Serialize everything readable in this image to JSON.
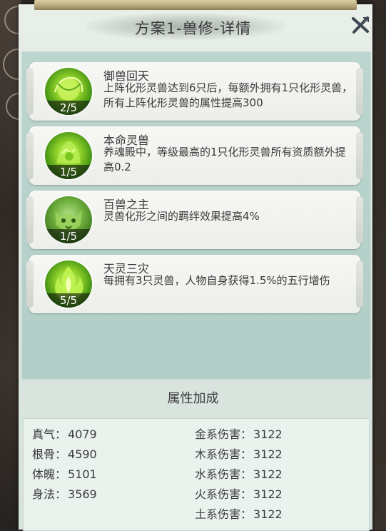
{
  "header": {
    "title": "方案1-兽修-详情"
  },
  "close_icon": "close-x-icon",
  "skills": [
    {
      "name": "御兽回天",
      "desc": "上阵化形灵兽达到6只后，每额外拥有1只化形灵兽，所有上阵化形灵兽的属性提高300",
      "level": "2/5",
      "icon": "green-beast-orb-icon"
    },
    {
      "name": "本命灵兽",
      "desc": "养魂殿中，等级最高的1只化形灵兽所有资质额外提高0.2",
      "level": "1/5",
      "icon": "green-beast-spirit-icon"
    },
    {
      "name": "百兽之主",
      "desc": "灵兽化形之间的羁绊效果提高4%",
      "level": "1/5",
      "icon": "green-tiger-head-icon"
    },
    {
      "name": "天灵三灾",
      "desc": "每拥有3只灵兽，人物自身获得1.5%的五行增伤",
      "level": "5/5",
      "icon": "green-spirit-flame-icon"
    }
  ],
  "attributes": {
    "title": "属性加成",
    "left": [
      {
        "label": "真气：",
        "value": "4079"
      },
      {
        "label": "根骨：",
        "value": "4590"
      },
      {
        "label": "体魄：",
        "value": "5101"
      },
      {
        "label": "身法：",
        "value": "3569"
      }
    ],
    "right": [
      {
        "label": "金系伤害：",
        "value": "3122"
      },
      {
        "label": "木系伤害：",
        "value": "3122"
      },
      {
        "label": "水系伤害：",
        "value": "3122"
      },
      {
        "label": "火系伤害：",
        "value": "3122"
      },
      {
        "label": "土系伤害：",
        "value": "3122"
      }
    ]
  },
  "colors": {
    "panel_bg": "#e9efe9",
    "list_bg": "#b8d2cb",
    "card_bg": "#f4f6f2",
    "text": "#3a3a3a",
    "icon_green": "#8fd12a"
  }
}
